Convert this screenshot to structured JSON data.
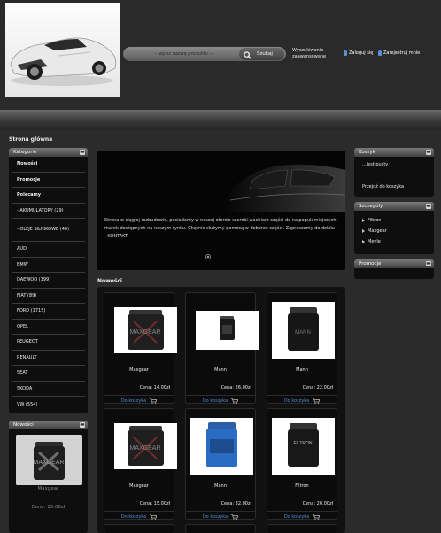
{
  "header": {
    "search_placeholder": "-- wpisz nazwę produktu --",
    "search_button": "Szukaj",
    "advanced_search": "Wyszukiwanie zaawansowane",
    "login": "Zaloguj się",
    "register": "Zarejestruj mnie"
  },
  "breadcrumb": "Strona główna",
  "categories": {
    "title": "Kategorie",
    "items": [
      "Nowości",
      "Promocje",
      "Polecamy",
      "- AKUMULATORY (29)",
      "- OLEJE SILNIKOWE (40)",
      "AUDI",
      "BMW",
      "DAEWOO (199)",
      "FIAT (89)",
      "FORD (1715)",
      "OPEL",
      "PEUGEOT",
      "RENAULT",
      "SEAT",
      "SKODA",
      "VW (554)"
    ]
  },
  "new_box": {
    "title": "Nowości",
    "product_name": "Maxgear",
    "product_price": "Cena: 15.00zł"
  },
  "slider": {
    "text": "Strona w ciągłej rozbudowie, posiadamy w naszej ofercie szeroki wachlarz części do najpopularniejszych marek dostępnych na naszym rynku. Chętnie służymy pomocą w doborze części. Zapraszamy do działu - KONTAKT"
  },
  "main": {
    "section_title": "Nowości",
    "buy_label": "Do koszyka",
    "products": [
      {
        "name": "Maxgear",
        "price": "Cena: 14.00zł"
      },
      {
        "name": "Mann",
        "price": "Cena: 26.00zł"
      },
      {
        "name": "Mann",
        "price": "Cena: 22.00zł"
      },
      {
        "name": "Maxgear",
        "price": "Cena: 15.00zł"
      },
      {
        "name": "Mann",
        "price": "Cena: 32.00zł"
      },
      {
        "name": "Filtron",
        "price": "Cena: 20.00zł"
      }
    ]
  },
  "cart": {
    "title": "Koszyk",
    "empty_text": "...jest pusty",
    "goto": "Przejdź do koszyka"
  },
  "details": {
    "title": "Szczególy",
    "items": [
      "Filtron",
      "Maxgear",
      "Meyle"
    ]
  },
  "promo": {
    "title": "Promocje"
  }
}
